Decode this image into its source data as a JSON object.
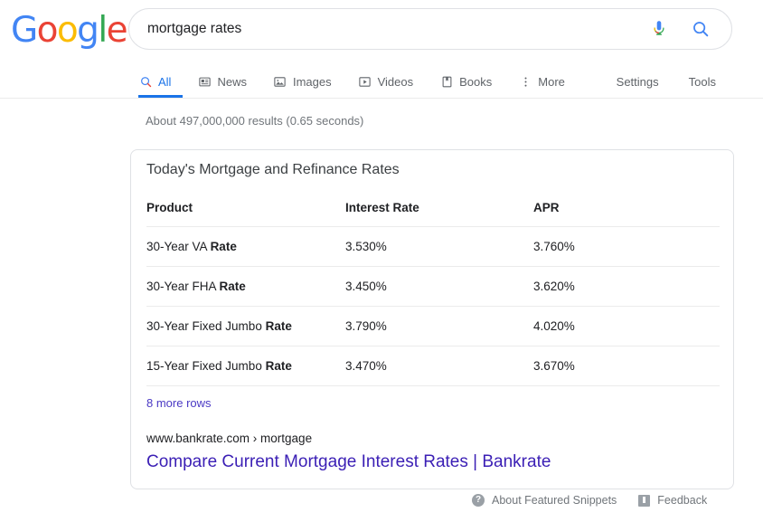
{
  "branding": {
    "logo_letters": [
      {
        "char": "G",
        "color": "#4285F4"
      },
      {
        "char": "o",
        "color": "#EA4335"
      },
      {
        "char": "o",
        "color": "#FBBC05"
      },
      {
        "char": "g",
        "color": "#4285F4"
      },
      {
        "char": "l",
        "color": "#34A853"
      },
      {
        "char": "e",
        "color": "#EA4335"
      }
    ]
  },
  "search": {
    "query": "mortgage rates",
    "placeholder": "Search",
    "mic_icon": "microphone-icon",
    "search_icon": "search-icon",
    "accent_blue": "#4285F4"
  },
  "nav": {
    "tabs": [
      {
        "label": "All",
        "icon": "search-icon",
        "active": true
      },
      {
        "label": "News",
        "icon": "news-icon",
        "active": false
      },
      {
        "label": "Images",
        "icon": "image-icon",
        "active": false
      },
      {
        "label": "Videos",
        "icon": "video-icon",
        "active": false
      },
      {
        "label": "Books",
        "icon": "book-icon",
        "active": false
      },
      {
        "label": "More",
        "icon": "more-vertical-icon",
        "active": false
      }
    ],
    "right_items": [
      {
        "label": "Settings"
      },
      {
        "label": "Tools"
      }
    ],
    "active_color": "#1a73e8"
  },
  "results": {
    "stats": "About 497,000,000 results (0.65 seconds)"
  },
  "snippet": {
    "title": "Today's Mortgage and Refinance Rates",
    "more_rows_label": "8 more rows",
    "result_url": "www.bankrate.com › mortgage",
    "result_title": "Compare Current Mortgage Interest Rates | Bankrate",
    "link_color": "#3b1fb5"
  },
  "chart_data": {
    "type": "table",
    "title": "Today's Mortgage and Refinance Rates",
    "columns": [
      "Product",
      "Interest Rate",
      "APR"
    ],
    "rows": [
      {
        "product_prefix": "30-Year VA ",
        "product_bold": "Rate",
        "interest_rate": "3.530%",
        "apr": "3.760%"
      },
      {
        "product_prefix": "30-Year FHA ",
        "product_bold": "Rate",
        "interest_rate": "3.450%",
        "apr": "3.620%"
      },
      {
        "product_prefix": "30-Year Fixed Jumbo ",
        "product_bold": "Rate",
        "interest_rate": "3.790%",
        "apr": "4.020%"
      },
      {
        "product_prefix": "15-Year Fixed Jumbo ",
        "product_bold": "Rate",
        "interest_rate": "3.470%",
        "apr": "3.670%"
      }
    ]
  },
  "footer": {
    "about_label": "About Featured Snippets",
    "feedback_label": "Feedback",
    "help_icon": "help-circle-icon",
    "feedback_icon": "feedback-flag-icon"
  }
}
